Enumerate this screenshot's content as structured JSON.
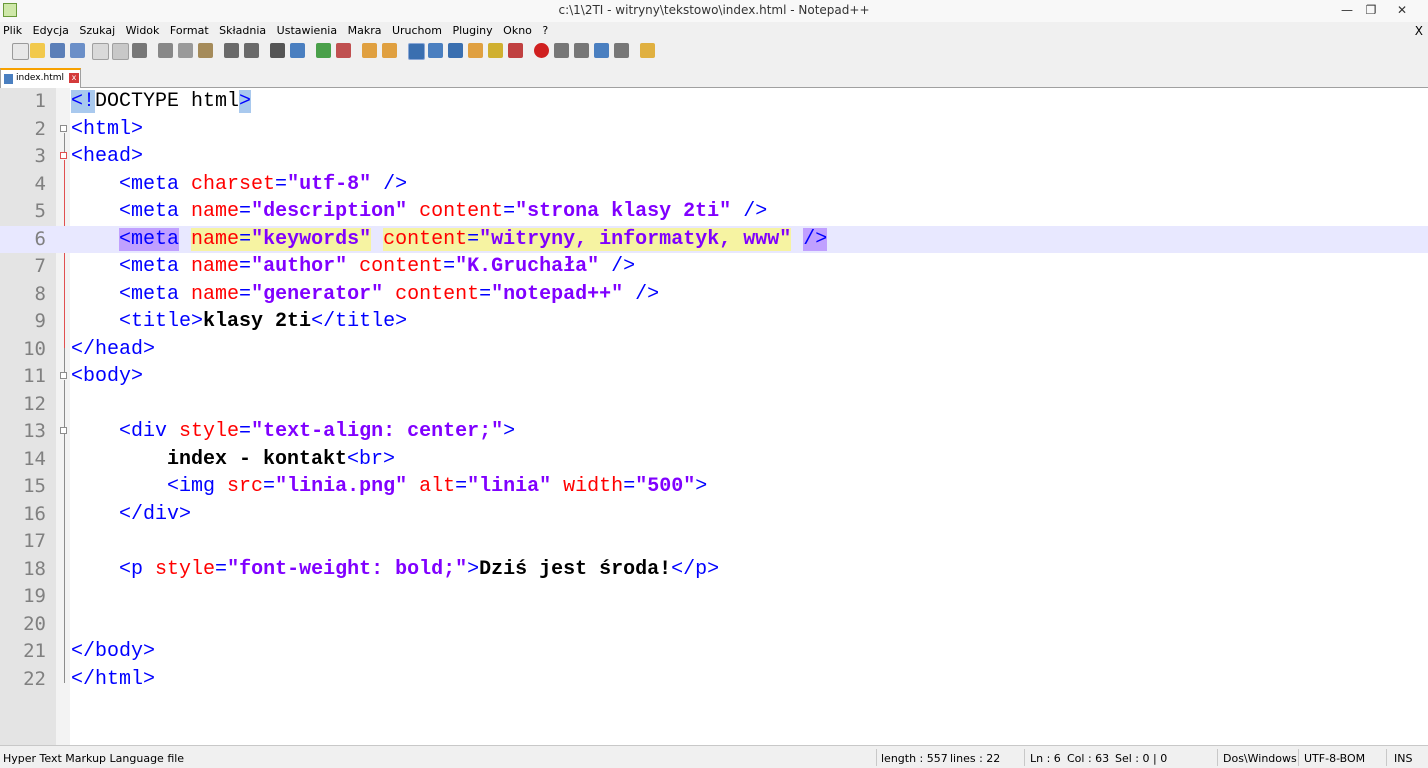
{
  "window": {
    "title": "c:\\1\\2TI - witryny\\tekstowo\\index.html - Notepad++"
  },
  "menu": [
    "Plik",
    "Edycja",
    "Szukaj",
    "Widok",
    "Format",
    "Składnia",
    "Ustawienia",
    "Makra",
    "Uruchom",
    "Pluginy",
    "Okno",
    "?"
  ],
  "menu_close": "X",
  "tab": {
    "label": "index.html",
    "close": "x"
  },
  "line_numbers": [
    "1",
    "2",
    "3",
    "4",
    "5",
    "6",
    "7",
    "8",
    "9",
    "10",
    "11",
    "12",
    "13",
    "14",
    "15",
    "16",
    "17",
    "18",
    "19",
    "20",
    "21",
    "22"
  ],
  "code": {
    "l1": {
      "open": "<!",
      "doctype": "DOCTYPE html",
      "close": ">"
    },
    "l2": "<html>",
    "l3": "<head>",
    "l4": {
      "indent": "    ",
      "t1": "<meta ",
      "a1": "charset",
      "eq1": "=",
      "v1": "\"utf-8\"",
      "t2": " />"
    },
    "l5": {
      "indent": "    ",
      "t1": "<meta ",
      "a1": "name",
      "eq1": "=",
      "v1": "\"description\"",
      "a2": "content",
      "eq2": "=",
      "v2": "\"strona klasy 2ti\"",
      "t2": " />"
    },
    "l6": {
      "indent": "    ",
      "t1": "<meta",
      "a1": "name",
      "eq1": "=",
      "v1": "\"keywords\"",
      "a2": "content",
      "eq2": "=",
      "v2": "\"witryny, informatyk, www\"",
      "t2": "/>"
    },
    "l7": {
      "indent": "    ",
      "t1": "<meta ",
      "a1": "name",
      "eq1": "=",
      "v1": "\"author\"",
      "a2": "content",
      "eq2": "=",
      "v2": "\"K.Gruchała\"",
      "t2": " />"
    },
    "l8": {
      "indent": "    ",
      "t1": "<meta ",
      "a1": "name",
      "eq1": "=",
      "v1": "\"generator\"",
      "a2": "content",
      "eq2": "=",
      "v2": "\"notepad++\"",
      "t2": " />"
    },
    "l9": {
      "indent": "    ",
      "t1": "<title>",
      "txt": "klasy 2ti",
      "t2": "</title>"
    },
    "l10": "</head>",
    "l11": "<body>",
    "l13": {
      "indent": "    ",
      "t1": "<div ",
      "a1": "style",
      "eq1": "=",
      "v1": "\"text-align: center;\"",
      "t2": ">"
    },
    "l14": {
      "indent": "        ",
      "txt": "index - kontakt",
      "t2": "<br>"
    },
    "l15": {
      "indent": "        ",
      "t1": "<img ",
      "a1": "src",
      "eq1": "=",
      "v1": "\"linia.png\"",
      "a2": "alt",
      "eq2": "=",
      "v2": "\"linia\"",
      "a3": "width",
      "eq3": "=",
      "v3": "\"500\"",
      "t2": ">"
    },
    "l16": {
      "indent": "    ",
      "t1": "</div>"
    },
    "l18": {
      "indent": "    ",
      "t1": "<p ",
      "a1": "style",
      "eq1": "=",
      "v1": "\"font-weight: bold;\"",
      "t2": ">",
      "txt": "Dziś jest środa!",
      "t3": "</p>"
    },
    "l21": "</body>",
    "l22": "</html>"
  },
  "status": {
    "filetype": "Hyper Text Markup Language file",
    "length": "length : 557",
    "lines": "lines : 22",
    "ln": "Ln : 6",
    "col": "Col : 63",
    "sel": "Sel : 0 | 0",
    "eol": "Dos\\Windows",
    "encoding": "UTF-8-BOM",
    "mode": "INS"
  }
}
